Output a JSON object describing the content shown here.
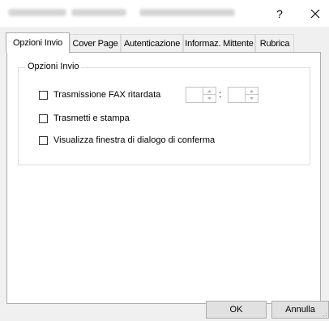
{
  "window": {
    "help_label": "?",
    "close_icon": "close-icon"
  },
  "tabs": [
    {
      "label": "Opzioni Invio",
      "active": true
    },
    {
      "label": "Cover Page",
      "active": false
    },
    {
      "label": "Autenticazione",
      "active": false
    },
    {
      "label": "Informaz. Mittente",
      "active": false
    },
    {
      "label": "Rubrica",
      "active": false
    }
  ],
  "group": {
    "title": "Opzioni Invio",
    "options": [
      {
        "label": "Trasmissione FAX ritardata",
        "checked": false
      },
      {
        "label": "Trasmetti e stampa",
        "checked": false
      },
      {
        "label": "Visualizza finestra di dialogo di conferma",
        "checked": false
      }
    ],
    "time_separator": ":",
    "hour_value": "",
    "minute_value": ""
  },
  "buttons": {
    "ok": "OK",
    "cancel": "Annulla"
  }
}
